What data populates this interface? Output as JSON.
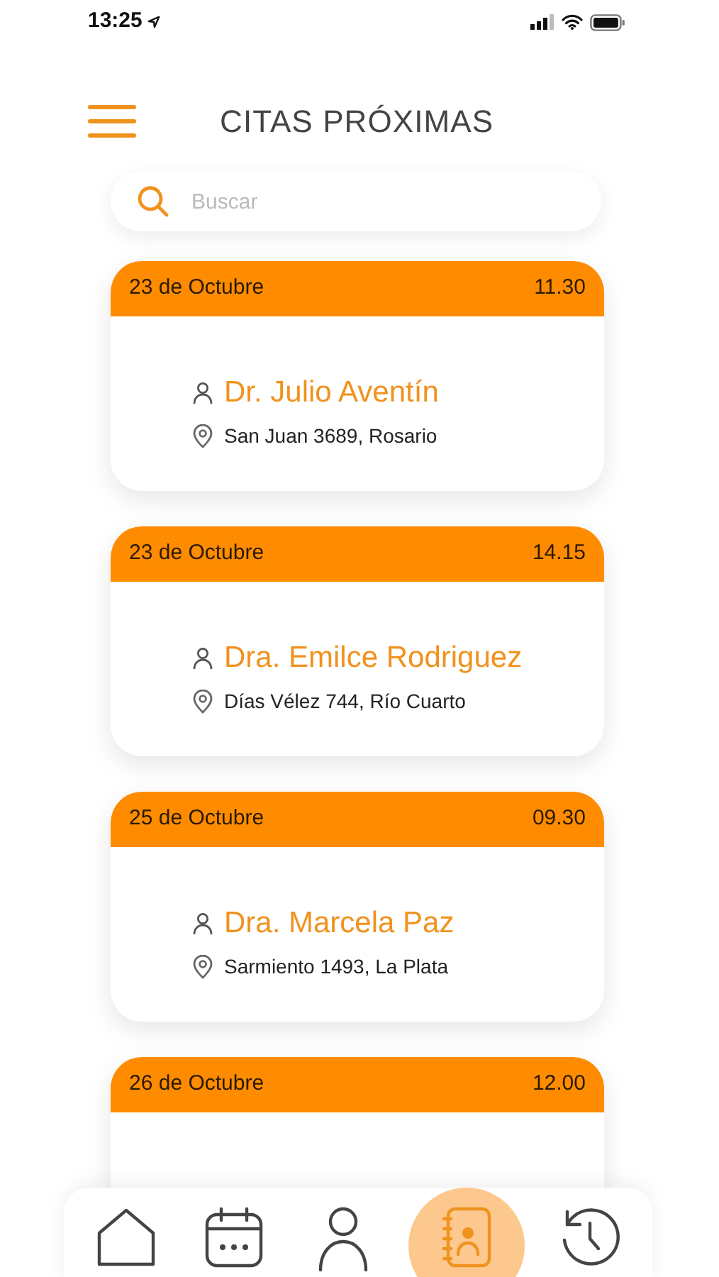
{
  "status_bar": {
    "time": "13:25"
  },
  "header": {
    "title": "CITAS PRÓXIMAS"
  },
  "search": {
    "placeholder": "Buscar"
  },
  "appointments": [
    {
      "date": "23 de Octubre",
      "time": "11.30",
      "doctor": "Dr. Julio Aventín",
      "address": "San Juan 3689, Rosario"
    },
    {
      "date": "23 de Octubre",
      "time": "14.15",
      "doctor": "Dra. Emilce Rodriguez",
      "address": "Días Vélez 744, Río Cuarto"
    },
    {
      "date": "25 de Octubre",
      "time": "09.30",
      "doctor": "Dra. Marcela Paz",
      "address": "Sarmiento 1493, La Plata"
    },
    {
      "date": "26 de Octubre",
      "time": "12.00"
    }
  ],
  "nav": {
    "items": [
      {
        "kind": "home",
        "selected": false
      },
      {
        "kind": "calendar",
        "selected": false
      },
      {
        "kind": "profile",
        "selected": false
      },
      {
        "kind": "contacts",
        "selected": true
      },
      {
        "kind": "history",
        "selected": false
      }
    ]
  }
}
